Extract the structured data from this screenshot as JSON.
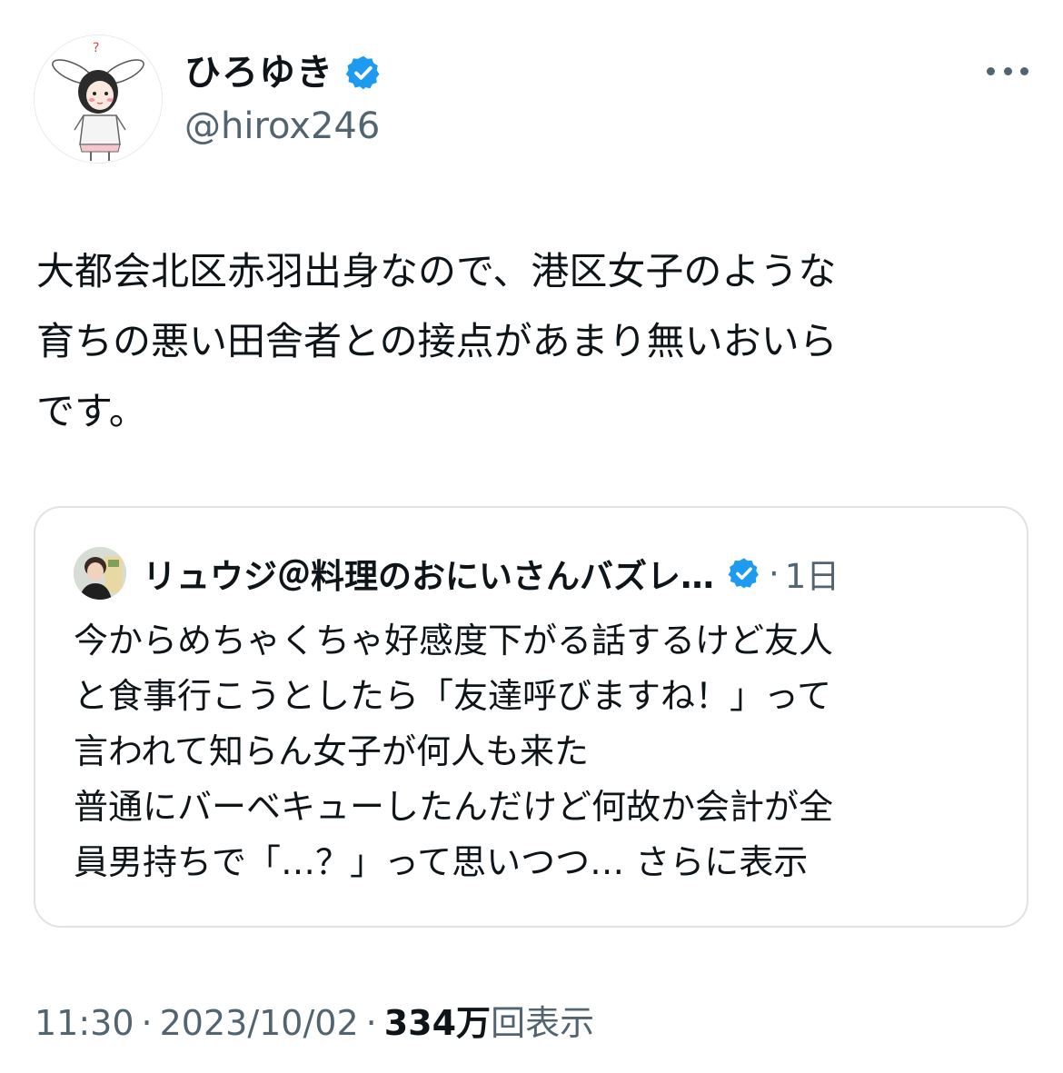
{
  "author": {
    "display_name": "ひろゆき",
    "handle": "@hirox246",
    "avatar": "cartoon-bunny-girl-avatar",
    "verified_icon": "verified-badge-icon"
  },
  "tweet": {
    "lines": [
      "大都会北区赤羽出身なので、港区女子のような",
      "育ちの悪い田舎者との接点があまり無いおいら",
      "です。"
    ]
  },
  "quote": {
    "author_name": "リュウジ＠料理のおにいさんバズレ…",
    "dot": "·",
    "time": "1日",
    "avatar": "person-photo-avatar",
    "body_lines": [
      "今からめちゃくちゃ好感度下がる話するけど友人",
      "と食事行こうとしたら「友達呼びますね！」って",
      "言われて知らん女子が何人も来た",
      "普通にバーベキューしたんだけど何故か会計が全",
      "員男持ちで「…？」って思いつつ…"
    ],
    "show_more": "さらに表示"
  },
  "meta": {
    "time": "11:30",
    "sep1": "·",
    "date": "2023/10/02",
    "sep2": "·",
    "views_count": "334万",
    "views_label": "回表示"
  },
  "colors": {
    "text": "#0f1419",
    "secondary": "#536471",
    "verified_blue": "#1d9bf0",
    "border": "#dfe3e7"
  }
}
